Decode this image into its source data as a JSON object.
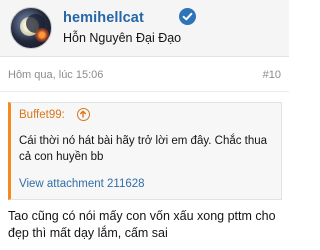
{
  "post": {
    "author": {
      "username": "hemihellcat",
      "title": "Hỗn Nguyên Đại Đạo"
    },
    "timestamp": "Hôm qua, lúc 15:06",
    "post_number": "#10",
    "quote": {
      "author_label": "Buffet99:",
      "text": "Cái thời nó hát bài hãy trở lời em đây. Chắc thua cả con huyền bb",
      "attachment_link": "View attachment 211628"
    },
    "message": "Tao cũng có nói mấy con vốn xấu xong pttm cho đẹp thì mất dạy lắm, cấm sai"
  },
  "colors": {
    "username": "#2566a8",
    "verified_badge": "#2f73b8",
    "quote_accent": "#f28a1e",
    "link": "#2f6ea8",
    "muted": "#8c8c8c"
  },
  "icons": {
    "verified": "check-circle-icon",
    "quote_jump": "arrow-up-circle-icon"
  }
}
